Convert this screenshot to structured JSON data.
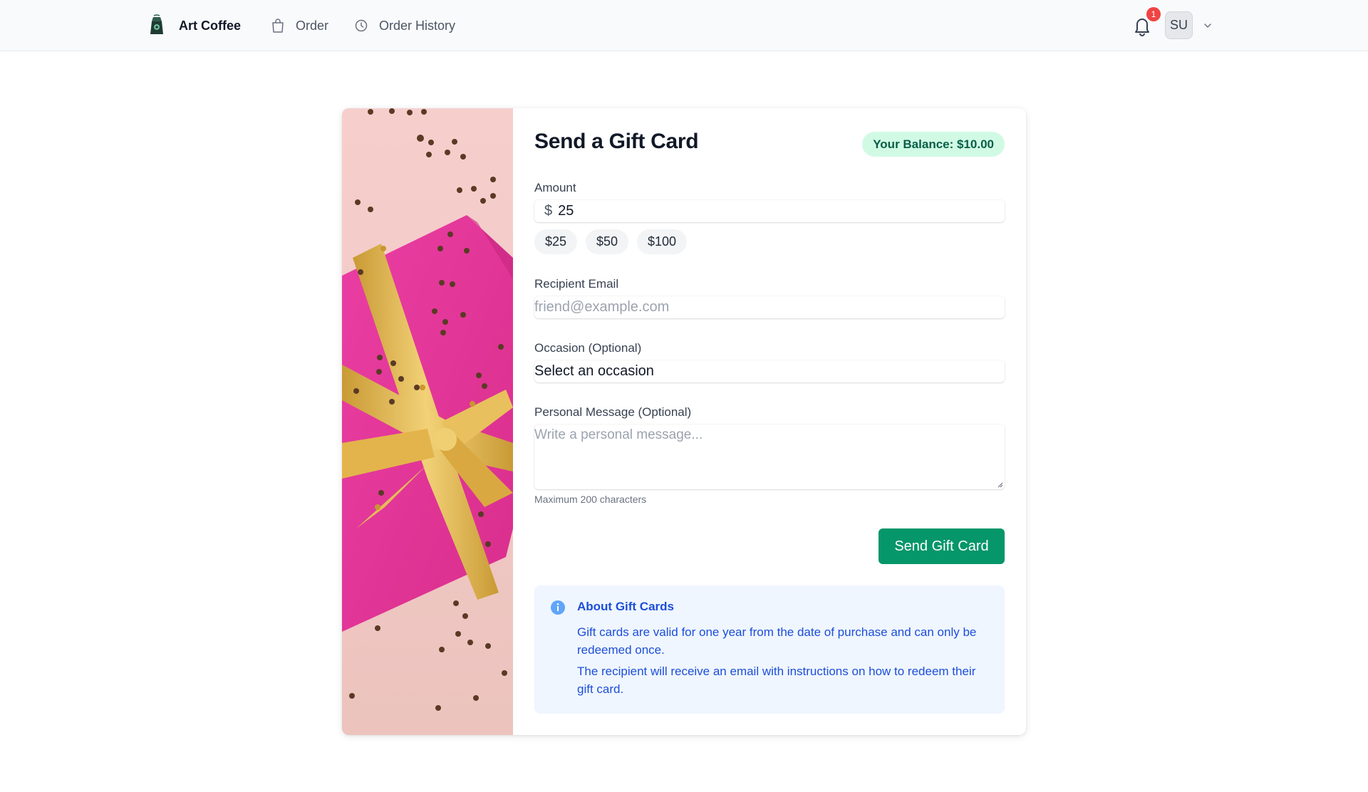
{
  "nav": {
    "brand": "Art Coffee",
    "links": [
      {
        "label": "Order",
        "icon": "shopping-bag-icon"
      },
      {
        "label": "Order History",
        "icon": "clock-icon"
      }
    ],
    "notification_count": "1",
    "avatar_initials": "SU"
  },
  "form": {
    "title": "Send a Gift Card",
    "balance": "Your Balance: $10.00",
    "amount_label": "Amount",
    "currency_symbol": "$",
    "amount_value": "25",
    "presets": [
      "$25",
      "$50",
      "$100"
    ],
    "recipient_label": "Recipient Email",
    "recipient_placeholder": "friend@example.com",
    "occasion_label": "Occasion (Optional)",
    "occasion_value": "Select an occasion",
    "message_label": "Personal Message (Optional)",
    "message_placeholder": "Write a personal message...",
    "message_helper": "Maximum 200 characters",
    "submit_label": "Send Gift Card"
  },
  "info": {
    "title": "About Gift Cards",
    "lines": [
      "Gift cards are valid for one year from the date of purchase and can only be redeemed once.",
      "The recipient will receive an email with instructions on how to redeem their gift card."
    ]
  },
  "colors": {
    "primary": "#059669",
    "balance_bg": "#d1fae5",
    "info_bg": "#eff6ff",
    "info_text": "#1d4ed8",
    "badge": "#ef4444",
    "gift_pink": "#e6369b",
    "ribbon_gold": "#e2b550"
  }
}
